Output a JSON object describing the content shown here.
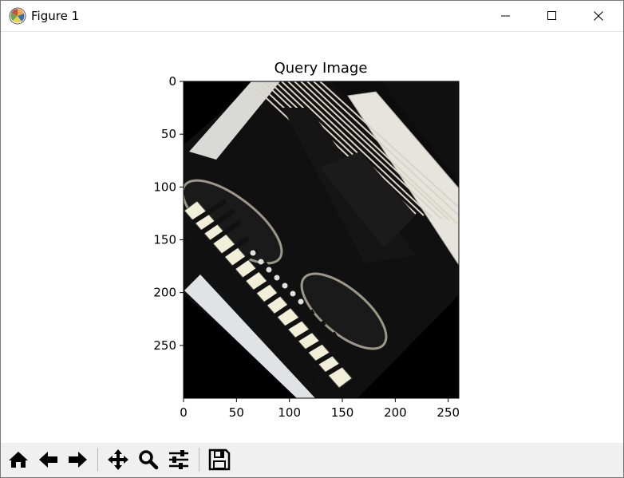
{
  "window": {
    "title": "Figure 1",
    "icons": [
      "matplotlib-icon",
      "minimize-icon",
      "maximize-icon",
      "close-icon"
    ]
  },
  "figure": {
    "title": "Query Image",
    "image_content": "accordion photo, rotated diagonally, on black background",
    "x_ticks": [
      "0",
      "50",
      "100",
      "150",
      "200",
      "250"
    ],
    "y_ticks": [
      "0",
      "50",
      "100",
      "150",
      "200",
      "250"
    ],
    "xlim": [
      0,
      260
    ],
    "ylim": [
      300,
      0
    ]
  },
  "toolbar": {
    "buttons": [
      {
        "name": "home-button",
        "icon": "home-icon"
      },
      {
        "name": "back-button",
        "icon": "arrow-left-icon"
      },
      {
        "name": "forward-button",
        "icon": "arrow-right-icon"
      },
      {
        "name": "pan-button",
        "icon": "move-icon"
      },
      {
        "name": "zoom-button",
        "icon": "magnifier-icon"
      },
      {
        "name": "configure-subplots-button",
        "icon": "sliders-icon"
      },
      {
        "name": "save-button",
        "icon": "floppy-disk-icon"
      }
    ]
  }
}
